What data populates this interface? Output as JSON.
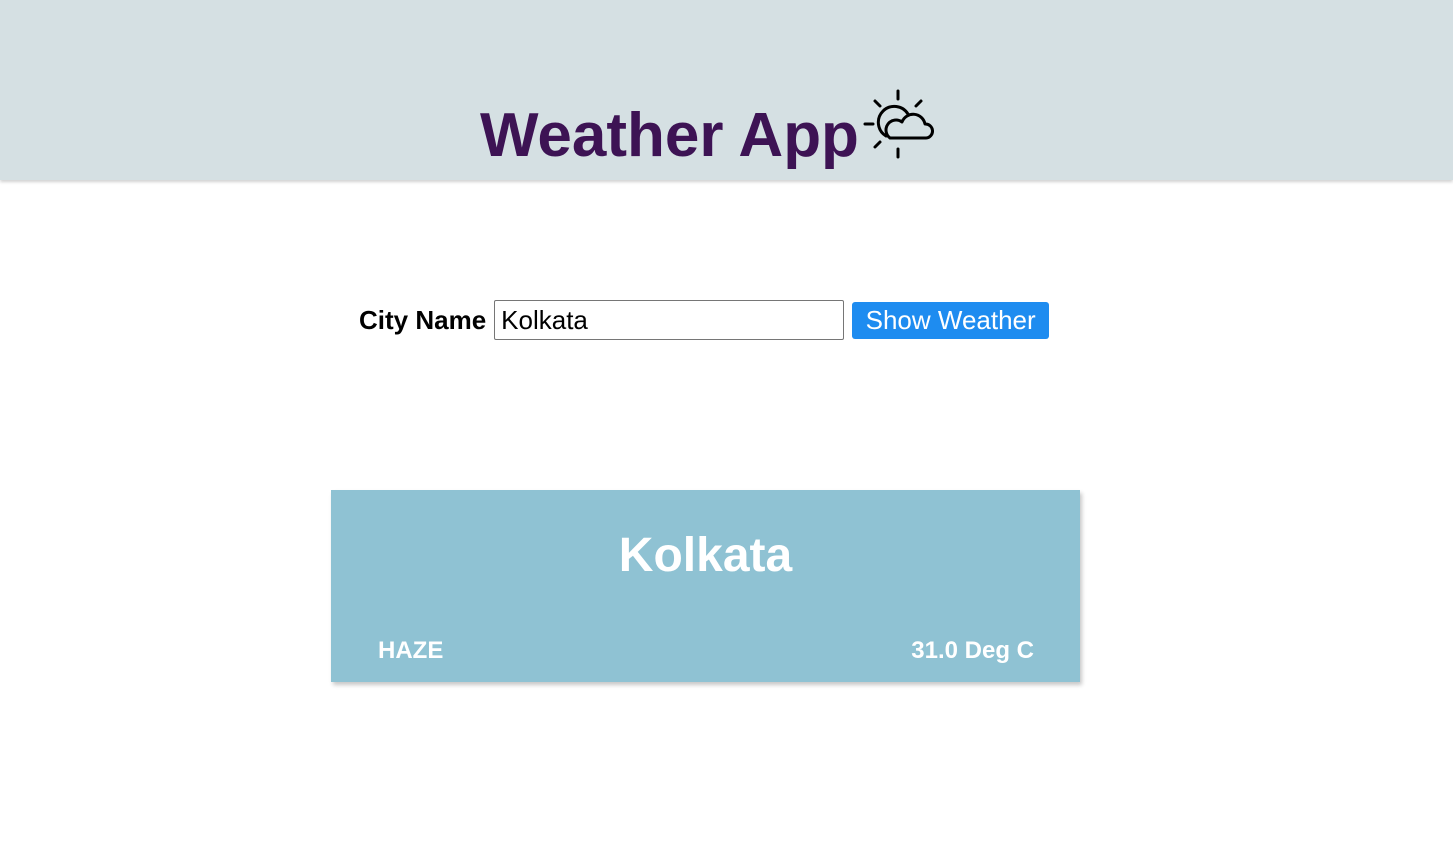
{
  "header": {
    "title": "Weather App",
    "icon": "sun-cloud-icon",
    "background": "#d5e0e3",
    "title_color": "#3d1354"
  },
  "search": {
    "label": "City Name",
    "value": "Kolkata",
    "button_label": "Show Weather",
    "button_color": "#1e8cf0"
  },
  "result": {
    "city": "Kolkata",
    "condition": "HAZE",
    "temperature": "31.0 Deg C",
    "card_color": "#8fc2d3"
  }
}
